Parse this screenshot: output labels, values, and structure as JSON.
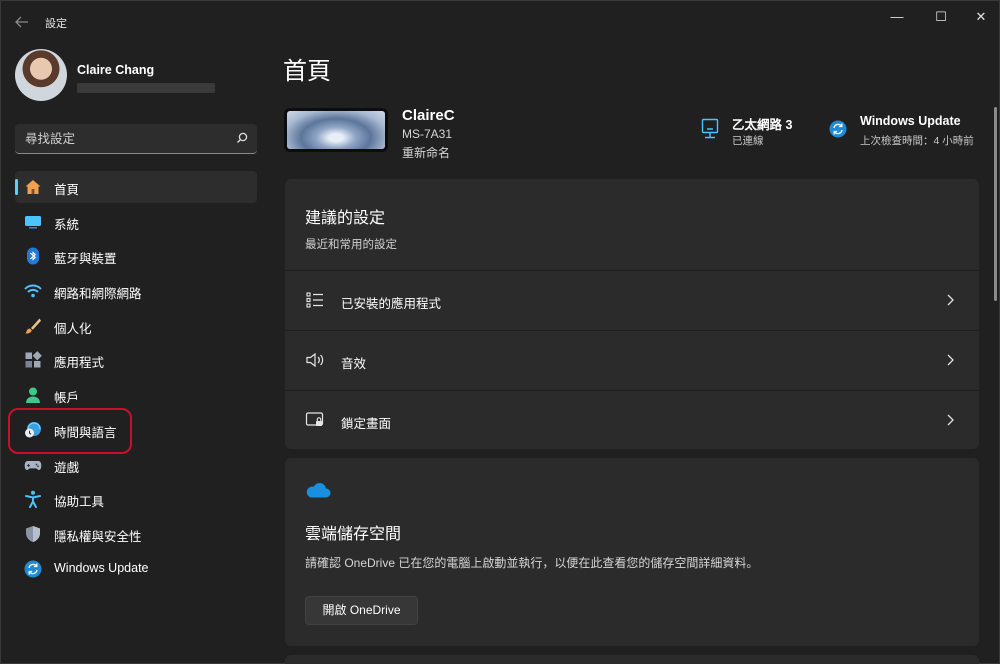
{
  "app": {
    "title": "設定",
    "controls": {
      "minimize": "—",
      "maximize": "☐",
      "close": "✕"
    }
  },
  "profile": {
    "name": "Claire Chang"
  },
  "search": {
    "placeholder": "尋找設定"
  },
  "sidebar": {
    "items": [
      {
        "label": "首頁",
        "icon": "home-icon",
        "active": true
      },
      {
        "label": "系統",
        "icon": "system-icon"
      },
      {
        "label": "藍牙與裝置",
        "icon": "bluetooth-icon"
      },
      {
        "label": "網路和網際網路",
        "icon": "wifi-icon"
      },
      {
        "label": "個人化",
        "icon": "brush-icon"
      },
      {
        "label": "應用程式",
        "icon": "apps-icon"
      },
      {
        "label": "帳戶",
        "icon": "account-icon"
      },
      {
        "label": "時間與語言",
        "icon": "globe-clock-icon",
        "highlighted": true
      },
      {
        "label": "遊戲",
        "icon": "gamepad-icon"
      },
      {
        "label": "協助工具",
        "icon": "accessibility-icon"
      },
      {
        "label": "隱私權與安全性",
        "icon": "shield-icon"
      },
      {
        "label": "Windows Update",
        "icon": "windows-update-icon"
      }
    ]
  },
  "main": {
    "title": "首頁",
    "device": {
      "name": "ClaireC",
      "model": "MS-7A31",
      "rename": "重新命名"
    },
    "status": {
      "network": {
        "title": "乙太網路 3",
        "subtitle": "已連線",
        "icon": "ethernet-icon"
      },
      "update": {
        "title": "Windows Update",
        "subtitle": "上次檢查時間：4 小時前",
        "icon": "windows-update-icon"
      }
    },
    "recommended": {
      "title": "建議的設定",
      "subtitle": "最近和常用的設定",
      "rows": [
        {
          "label": "已安裝的應用程式",
          "icon": "installed-apps-icon"
        },
        {
          "label": "音效",
          "icon": "speaker-icon"
        },
        {
          "label": "鎖定畫面",
          "icon": "lock-screen-icon"
        }
      ]
    },
    "cloud": {
      "title": "雲端儲存空間",
      "description": "請確認 OneDrive 已在您的電腦上啟動並執行，以便在此查看您的儲存空間詳細資料。",
      "button": "開啟 OneDrive",
      "icon": "cloud-icon"
    }
  },
  "colors": {
    "accent": "#60cdff",
    "highlight": "#c8102e",
    "background": "#202020",
    "card": "#2b2b2b"
  }
}
